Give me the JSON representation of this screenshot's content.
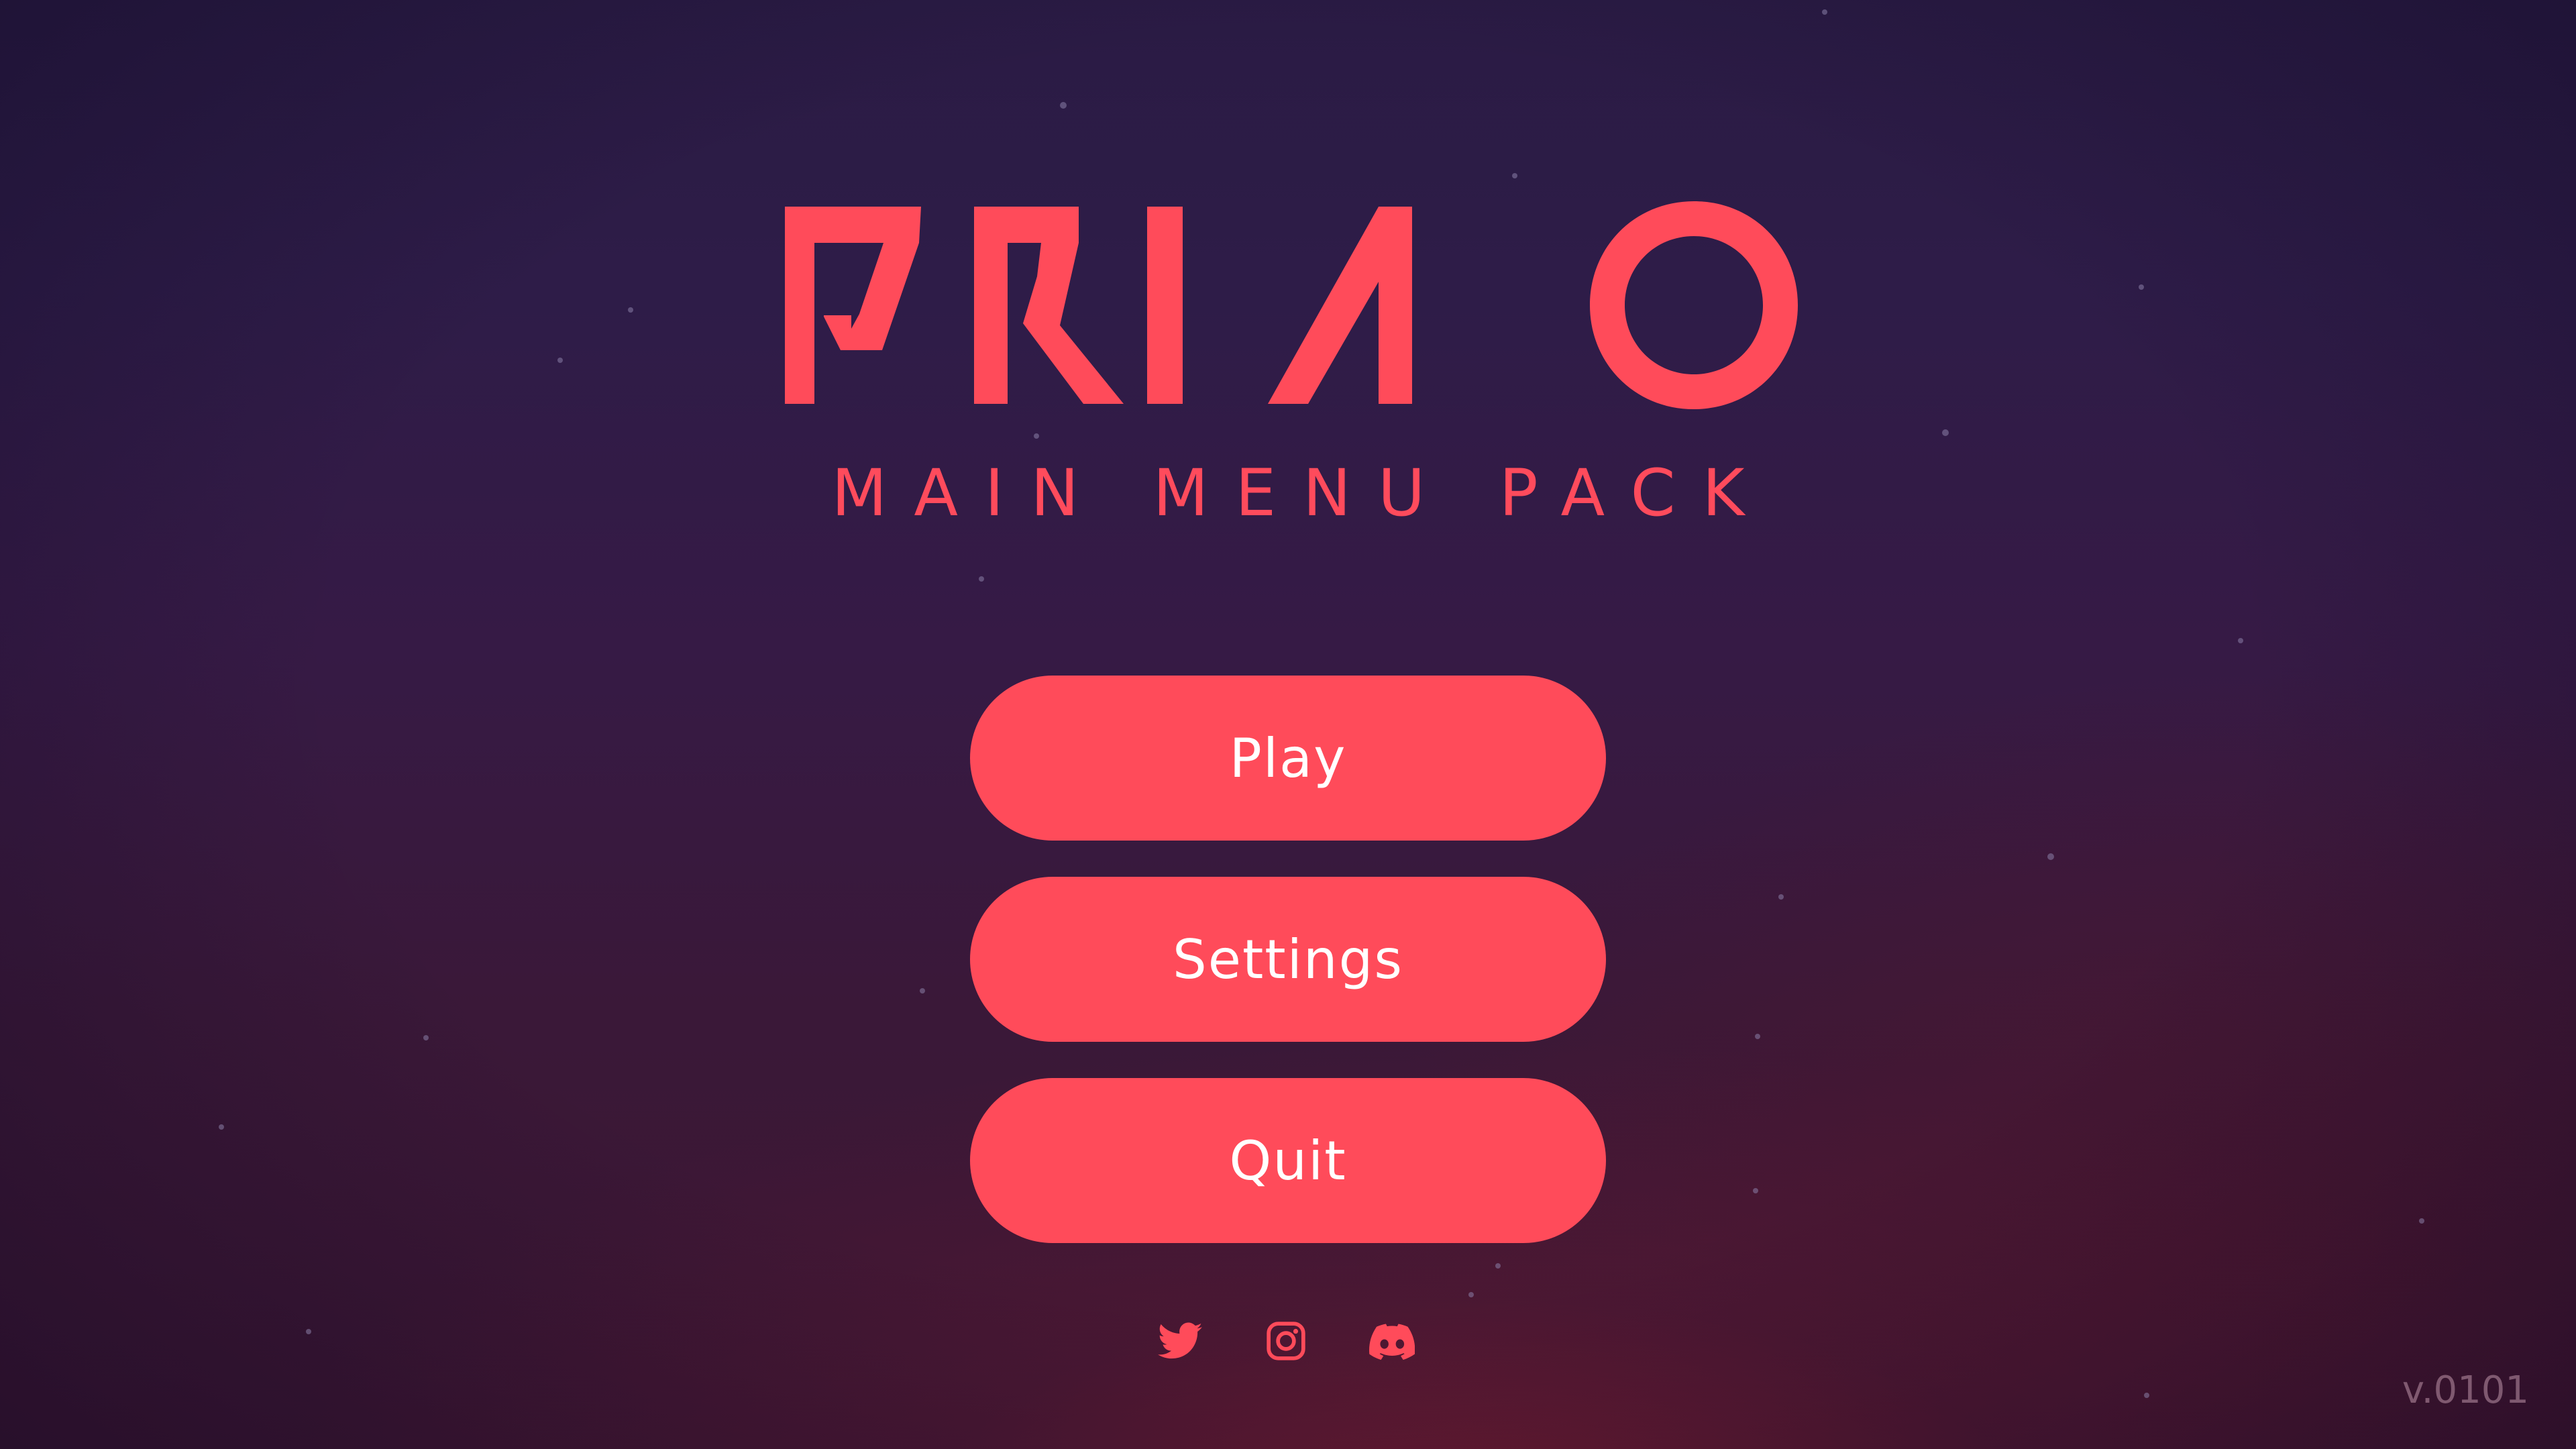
{
  "logo": {
    "text": "PRIMO"
  },
  "subtitle": "MAIN MENU PACK",
  "menu": {
    "items": [
      {
        "label": "Play"
      },
      {
        "label": "Settings"
      },
      {
        "label": "Quit"
      }
    ]
  },
  "social": {
    "icons": [
      "twitter-icon",
      "instagram-icon",
      "discord-icon"
    ]
  },
  "version": "v.0101",
  "colors": {
    "accent": "#ff4b5a",
    "button_text": "#ffffff",
    "background_top": "#2a1b44",
    "background_bottom": "#3d1632"
  }
}
